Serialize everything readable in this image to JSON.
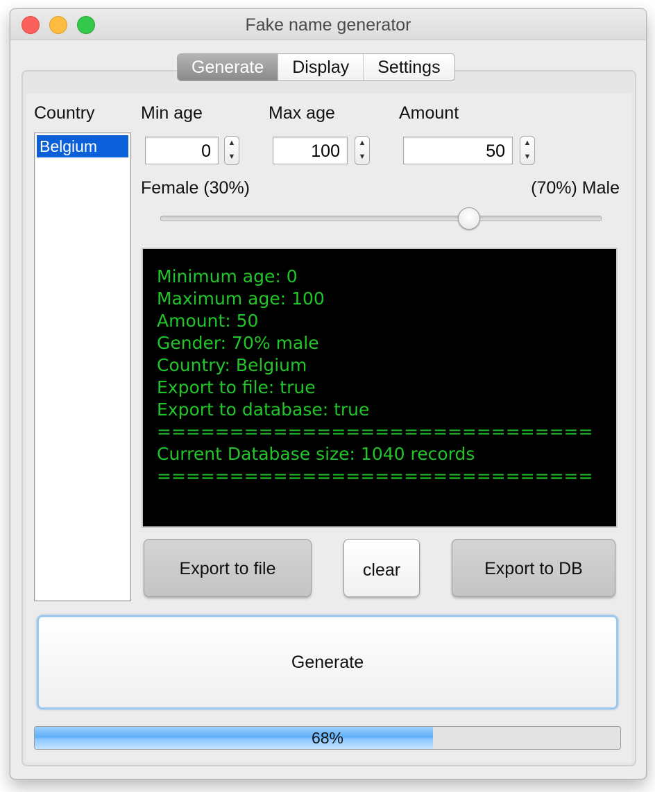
{
  "window": {
    "title": "Fake name generator"
  },
  "tabs": [
    {
      "label": "Generate",
      "active": true
    },
    {
      "label": "Display",
      "active": false
    },
    {
      "label": "Settings",
      "active": false
    }
  ],
  "country": {
    "label": "Country",
    "items": [
      "Belgium"
    ],
    "selected": "Belgium"
  },
  "min_age": {
    "label": "Min age",
    "value": "0"
  },
  "max_age": {
    "label": "Max age",
    "value": "100"
  },
  "amount": {
    "label": "Amount",
    "value": "50"
  },
  "gender": {
    "female_label": "Female (30%)",
    "male_label": "(70%) Male",
    "male_fraction": 0.7
  },
  "console": {
    "lines": [
      "Minimum age: 0",
      "Maximum age: 100",
      "Amount: 50",
      "Gender: 70% male",
      "Country: Belgium",
      "Export to file: true",
      "Export to database: true",
      "==============================",
      "Current Database size: 1040 records",
      "=============================="
    ]
  },
  "buttons": {
    "export_file": "Export to file",
    "clear": "clear",
    "export_db": "Export to DB",
    "generate": "Generate"
  },
  "progress": {
    "percent": 68,
    "text": "68%"
  },
  "colors": {
    "console_text": "#21c52a",
    "selection": "#0b5fd8",
    "progress_fill": "#5eaef5"
  }
}
